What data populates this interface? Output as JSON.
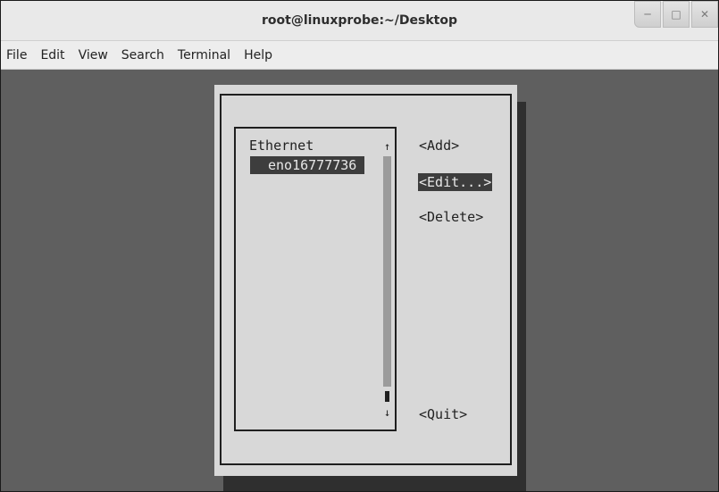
{
  "window": {
    "title": "root@linuxprobe:~/Desktop"
  },
  "window_controls": [
    "minimize-icon",
    "maximize-icon",
    "close-icon"
  ],
  "menubar": {
    "items": [
      "File",
      "Edit",
      "View",
      "Search",
      "Terminal",
      "Help"
    ]
  },
  "nmtui": {
    "list": {
      "heading": "Ethernet",
      "items": [
        "eno16777736"
      ],
      "selected": "eno16777736"
    },
    "scrollbar": {
      "up_arrow": "↑",
      "down_arrow": "↓"
    },
    "buttons": {
      "add": "<Add>",
      "edit": "<Edit...>",
      "delete": "<Delete>",
      "quit": "<Quit>"
    },
    "focused_button": "edit"
  },
  "colors": {
    "terminal_bg": "#5f5f5f",
    "dialog_bg": "#d8d8d8",
    "highlight_bg": "#3d3d3d",
    "highlight_fg": "#e8e8e8"
  }
}
